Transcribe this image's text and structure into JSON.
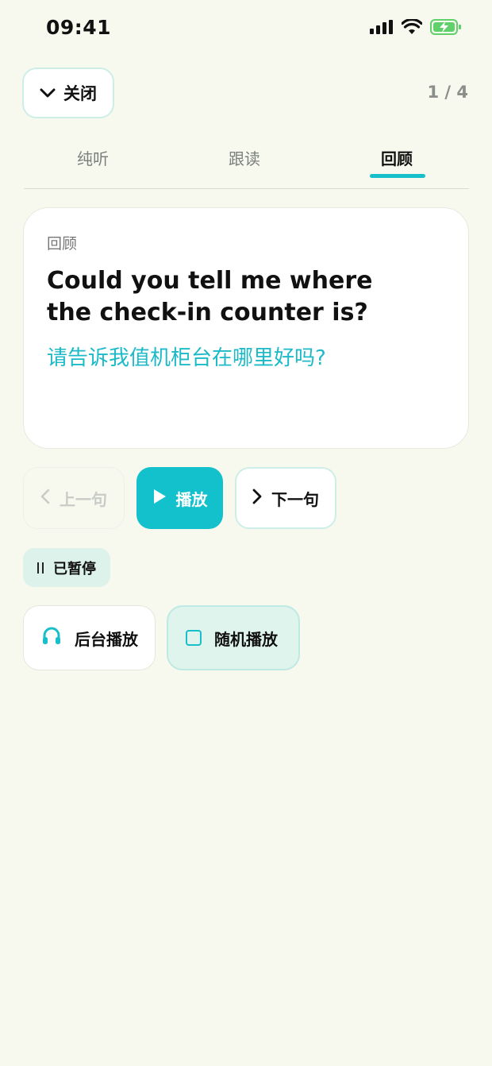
{
  "status_bar": {
    "time": "09:41"
  },
  "header": {
    "close_label": "关闭",
    "progress": "1 / 4"
  },
  "tabs": [
    {
      "label": "纯听",
      "active": false
    },
    {
      "label": "跟读",
      "active": false
    },
    {
      "label": "回顾",
      "active": true
    }
  ],
  "card": {
    "label": "回顾",
    "english": "Could you tell me where the check-in counter is?",
    "chinese": "请告诉我值机柜台在哪里好吗?"
  },
  "controls": {
    "prev_label": "上一句",
    "play_label": "播放",
    "next_label": "下一句"
  },
  "playback_state": {
    "label": "已暂停"
  },
  "options": {
    "background_label": "后台播放",
    "shuffle_label": "随机播放",
    "shuffle_checked": false
  },
  "colors": {
    "accent": "#12c1cc",
    "background": "#f7f9ee"
  }
}
